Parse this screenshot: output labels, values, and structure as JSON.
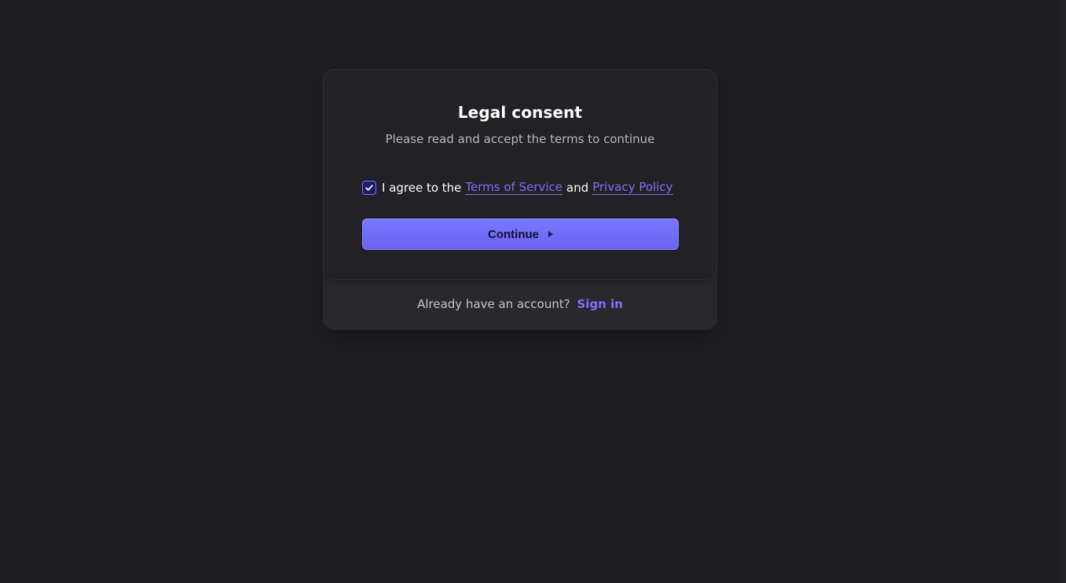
{
  "card": {
    "title": "Legal consent",
    "subtitle": "Please read and accept the terms to continue"
  },
  "consent": {
    "checked": true,
    "prefix": "I agree to the",
    "terms_link": "Terms of Service",
    "and": "and",
    "privacy_link": "Privacy Policy"
  },
  "actions": {
    "continue_label": "Continue",
    "continue_icon": "play-triangle-icon"
  },
  "footer": {
    "text": "Already have an account?",
    "signin_label": "Sign in"
  },
  "colors": {
    "background": "#1f1f23",
    "card": "#212126",
    "accent": "#7b72ff",
    "button_start": "#7978ff",
    "button_end": "#6b62f2",
    "title": "#ffffff",
    "muted": "#b8b8bf"
  }
}
